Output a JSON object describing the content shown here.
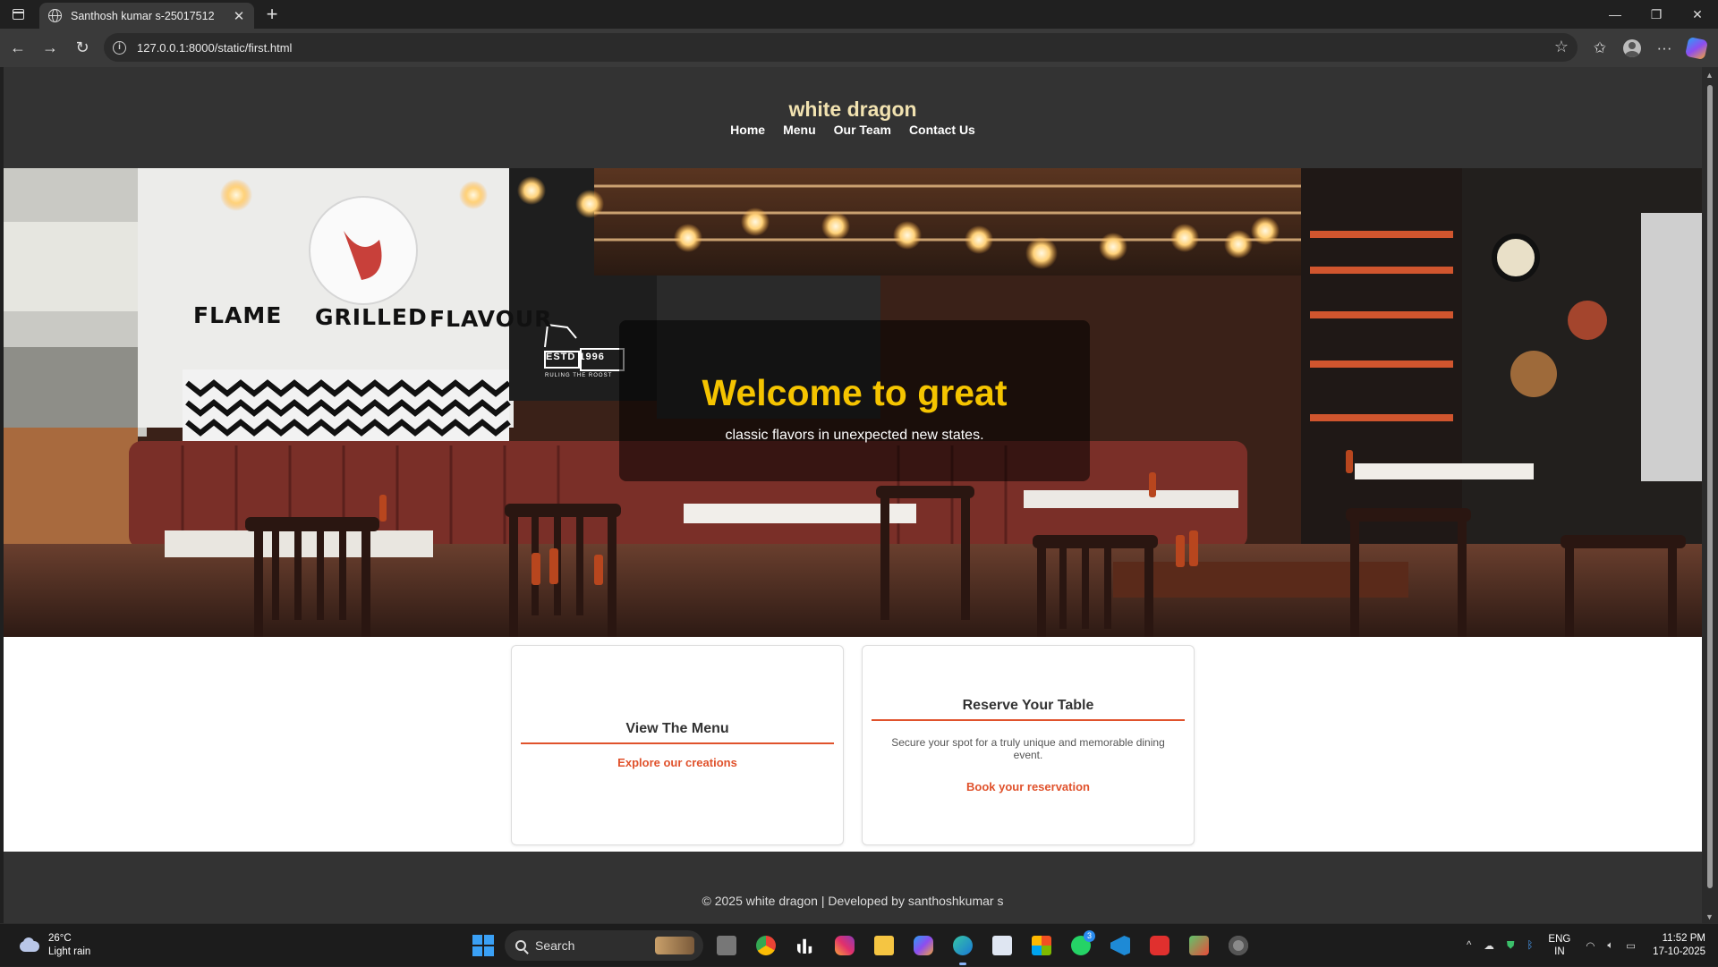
{
  "browser": {
    "tab_title": "Santhosh kumar s-25017512",
    "address": "127.0.0.1:8000/static/first.html"
  },
  "site": {
    "brand": "white dragon",
    "nav": [
      "Home",
      "Menu",
      "Our Team",
      "Contact Us"
    ],
    "hero": {
      "title": "Welcome to great",
      "subtitle": "classic flavors in unexpected new states.",
      "sign_words": [
        "FLAME",
        "GRILLED",
        "FLAVOUR"
      ],
      "estd_badge": "ESTD 1996",
      "badge_tagline": "RULING THE ROOST"
    },
    "cards": [
      {
        "title": "View The Menu",
        "description": "",
        "link": "Explore our creations"
      },
      {
        "title": "Reserve Your Table",
        "description": "Secure your spot for a truly unique and memorable dining event.",
        "link": "Book your reservation"
      }
    ],
    "footer": "© 2025 white dragon | Developed by santhoshkumar s"
  },
  "taskbar": {
    "weather": {
      "temp": "26°C",
      "desc": "Light rain"
    },
    "search_label": "Search",
    "lang": [
      "ENG",
      "IN"
    ],
    "time": "11:52 PM",
    "date": "17-10-2025",
    "whatsapp_badge": "3"
  },
  "colors": {
    "header_bg": "#333333",
    "brand": "#f1e2b0",
    "hero_title": "#f5c400",
    "accent": "#e0522c"
  }
}
